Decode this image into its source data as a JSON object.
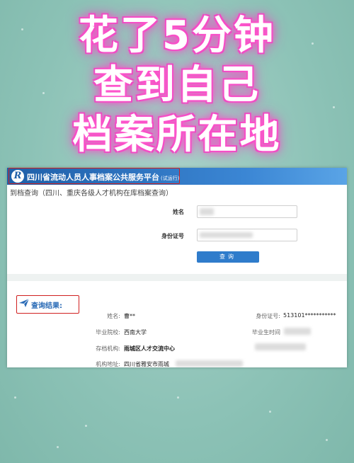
{
  "headline": {
    "line1": "花了5分钟",
    "line2": "查到自己",
    "line3": "档案所在地"
  },
  "colors": {
    "background": "#8cc2b6",
    "banner": "#2f7ccb",
    "highlight_box": "#d02020",
    "neon_glow": "#ff4fc8",
    "button": "#2f7ccb"
  },
  "site": {
    "logo": "R",
    "title": "四川省流动人员人事档案公共服务平台",
    "tag": "(试运行)",
    "subtitle": "到档查询（四川、重庆各级人才机构在库档案查询）"
  },
  "form": {
    "name_label": "姓名",
    "id_label": "身份证号",
    "query_button": "查询"
  },
  "result": {
    "title": "查询结果:",
    "name_label": "姓名:",
    "name_value": "曹**",
    "id_label": "身份证号:",
    "id_value": "513101***********",
    "school_label": "毕业院校:",
    "school_value": "西南大学",
    "grad_time_label": "毕业生时间",
    "archive_org_label": "存档机构:",
    "archive_org_value": "雨城区人才交流中心",
    "org_address_label": "机构地址:",
    "org_address_value": "四川省雅安市雨城"
  },
  "icons": {
    "logo_icon": "circle-R-logo",
    "result_icon": "paper-plane-icon"
  }
}
